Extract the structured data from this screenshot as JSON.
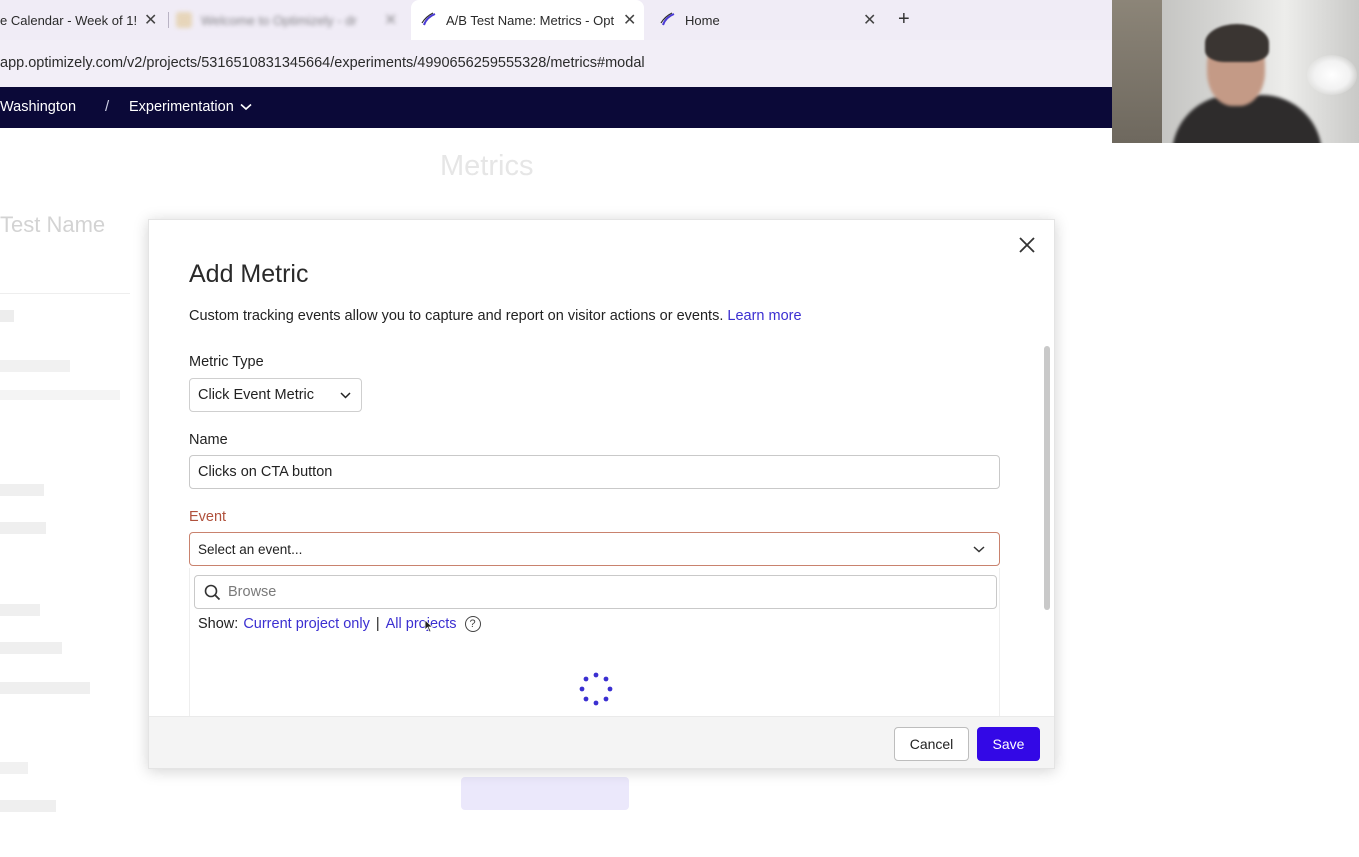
{
  "browser": {
    "tabs": [
      {
        "title": "e Calendar - Week of 1!",
        "active": false
      },
      {
        "title": "Welcome to Optimizely - dr",
        "active": false,
        "blurred": true
      },
      {
        "title": "A/B Test Name: Metrics - Opt",
        "active": true
      },
      {
        "title": "Home",
        "active": false
      }
    ],
    "new_tab_icon": "plus-icon",
    "url": "app.optimizely.com/v2/projects/5316510831345664/experiments/4990656259555328/metrics#modal"
  },
  "app_nav": {
    "org": "Washington",
    "separator": "/",
    "section": "Experimentation"
  },
  "background_page": {
    "heading": "Metrics",
    "test_name": "Test Name"
  },
  "modal": {
    "title": "Add Metric",
    "description": "Custom tracking events allow you to capture and report on visitor actions or events.",
    "learn_more": "Learn more",
    "metric_type": {
      "label": "Metric Type",
      "value": "Click Event Metric"
    },
    "name": {
      "label": "Name",
      "value": "Clicks on CTA button"
    },
    "event": {
      "label": "Event",
      "placeholder": "Select an event...",
      "browse_placeholder": "Browse",
      "show_label": "Show:",
      "current_project": "Current project only",
      "divider": "|",
      "all_projects": "All projects",
      "help": "?"
    },
    "buttons": {
      "cancel": "Cancel",
      "save": "Save"
    }
  },
  "colors": {
    "nav_bg": "#0b0938",
    "primary": "#3308e6",
    "link": "#3b2fd1",
    "event_label": "#b0513c"
  }
}
